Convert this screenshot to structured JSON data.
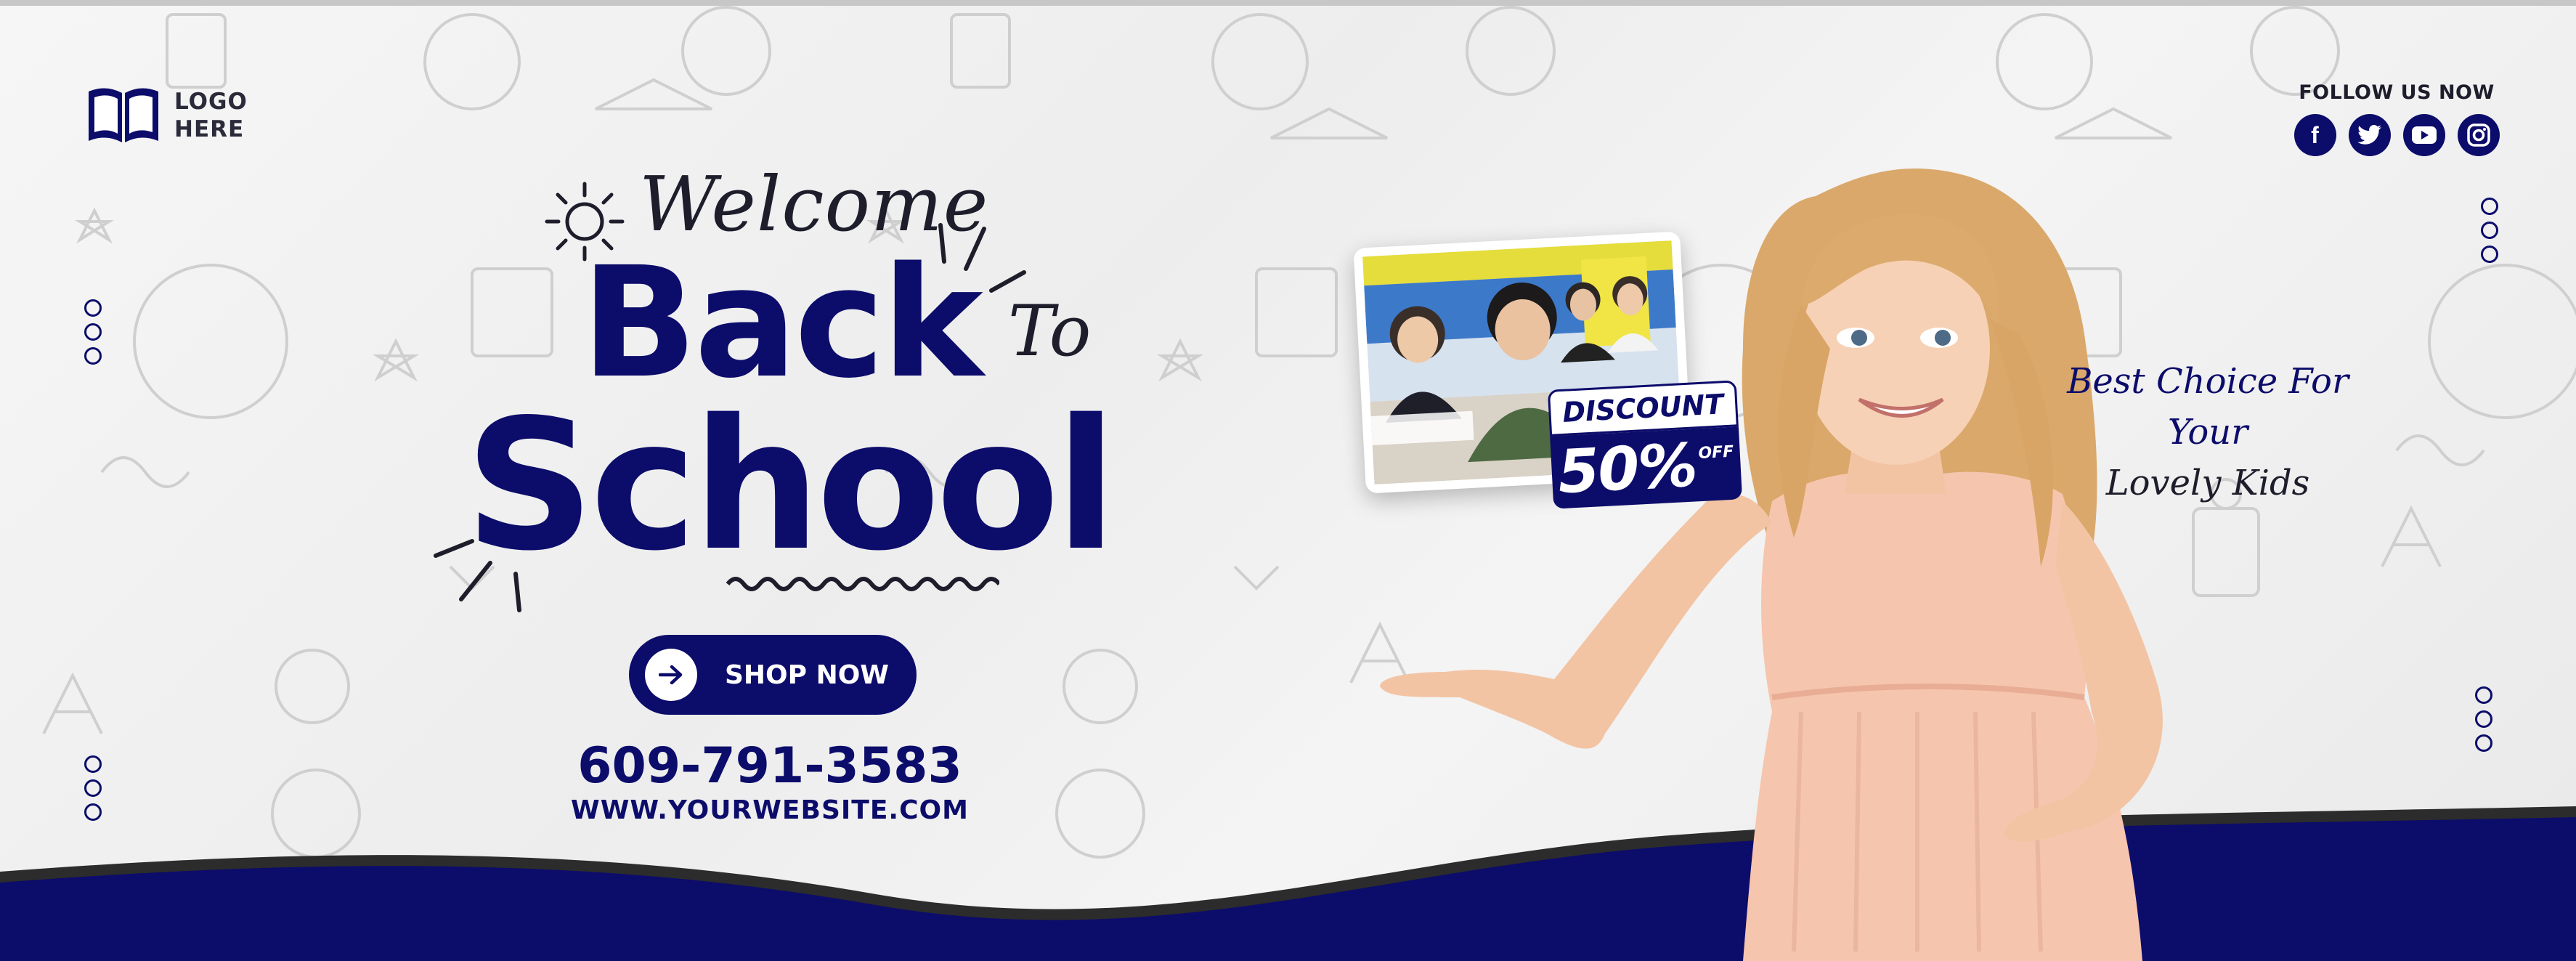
{
  "brand": {
    "logo_line1": "LOGO",
    "logo_line2": "HERE"
  },
  "social": {
    "title": "FOLLOW US NOW",
    "icons": [
      "facebook-icon",
      "twitter-icon",
      "youtube-icon",
      "instagram-icon"
    ]
  },
  "headline": {
    "welcome": "Welcome",
    "back": "Back",
    "to": "To",
    "school": "School"
  },
  "cta": {
    "label": "SHOP NOW",
    "icon": "arrow-right-icon"
  },
  "contact": {
    "phone": "609-791-3583",
    "website": "WWW.YOURWEBSITE.COM"
  },
  "promo": {
    "discount_label": "DISCOUNT",
    "percent": "50%",
    "off": "OFF"
  },
  "tagline": {
    "line1": "Best Choice For Your",
    "line2": "Lovely Kids"
  },
  "colors": {
    "primary": "#0c0c6b",
    "dark_text": "#1d1d2b",
    "background": "#f1f1f1"
  }
}
